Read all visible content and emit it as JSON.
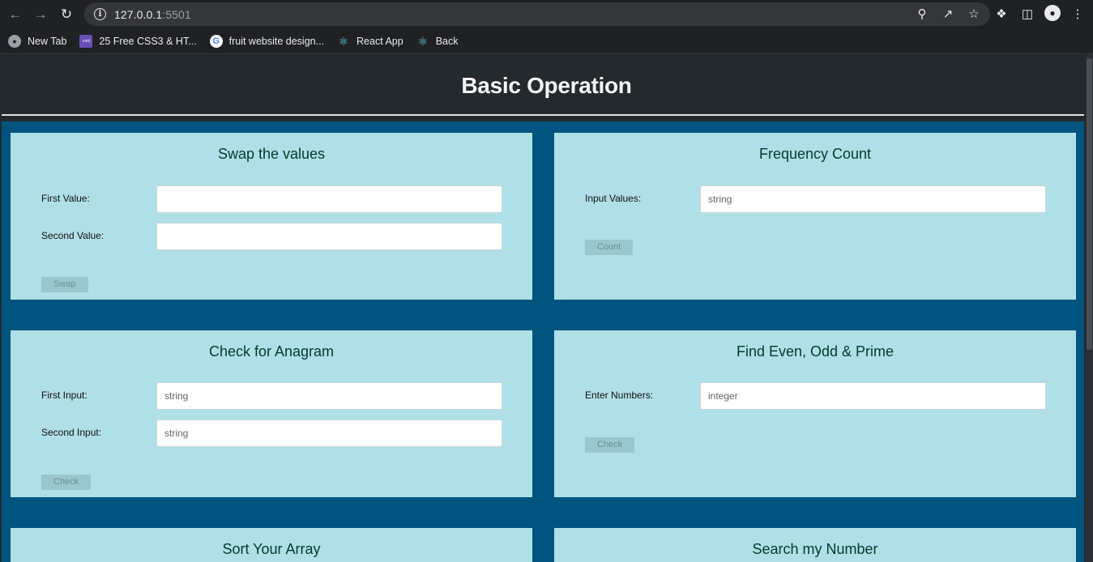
{
  "browser": {
    "url_host": "127.0.0.1",
    "url_port": ":5501",
    "bookmarks": [
      {
        "label": "New Tab",
        "icon": "globe-icon"
      },
      {
        "label": "25 Free CSS3 & HT...",
        "icon": "coolors-icon"
      },
      {
        "label": "fruit website design...",
        "icon": "google-icon"
      },
      {
        "label": "React App",
        "icon": "react-icon"
      },
      {
        "label": "Back",
        "icon": "react-icon"
      }
    ]
  },
  "page": {
    "title": "Basic Operation"
  },
  "cards": {
    "swap": {
      "title": "Swap the values",
      "first_label": "First Value:",
      "first_placeholder": "",
      "second_label": "Second Value:",
      "second_placeholder": "",
      "button": "Swap"
    },
    "frequency": {
      "title": "Frequency Count",
      "input_label": "Input Values:",
      "input_placeholder": "string",
      "button": "Count"
    },
    "anagram": {
      "title": "Check for Anagram",
      "first_label": "First Input:",
      "first_placeholder": "string",
      "second_label": "Second Input:",
      "second_placeholder": "string",
      "button": "Check"
    },
    "evenoddprime": {
      "title": "Find Even, Odd & Prime",
      "input_label": "Enter Numbers:",
      "input_placeholder": "integer",
      "button": "Check"
    },
    "sort": {
      "title": "Sort Your Array"
    },
    "search": {
      "title": "Search my Number"
    }
  },
  "colors": {
    "header_bg": "#24292e",
    "main_bg": "#005580",
    "card_bg": "#b0dfe6",
    "card_title": "#003d2b"
  }
}
